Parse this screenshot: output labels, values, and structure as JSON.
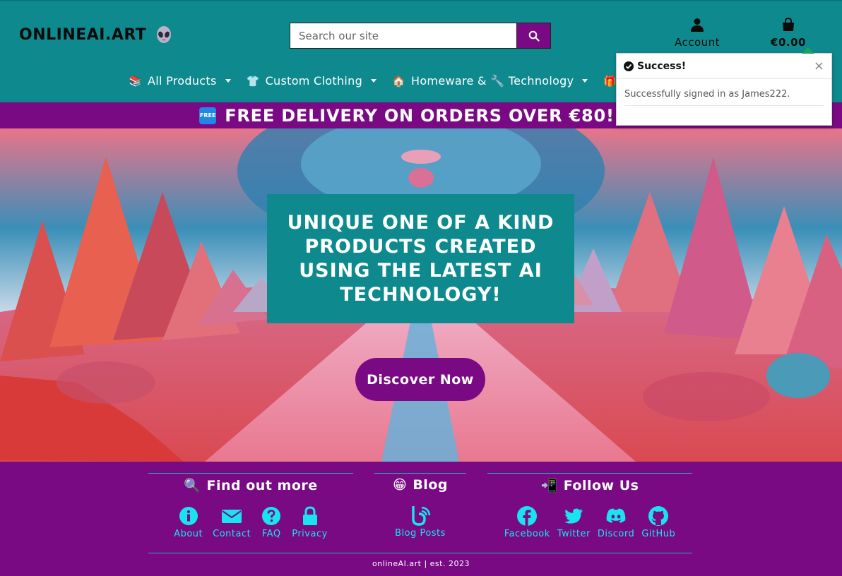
{
  "header": {
    "logo_text": "ONLINEAI.ART",
    "search_placeholder": "Search our site",
    "account_label": "Account",
    "cart_total": "€0.00"
  },
  "nav": {
    "items": [
      {
        "emoji": "📚",
        "label": "All Products"
      },
      {
        "emoji": "👕",
        "label": "Custom Clothing"
      },
      {
        "emoji": "🏠",
        "label": "Homeware & 🔧 Technology"
      },
      {
        "emoji": "🎁",
        "label": ""
      }
    ]
  },
  "banner": {
    "badge": "FREE",
    "text": "FREE DELIVERY ON ORDERS OVER €80!"
  },
  "toast": {
    "title": "Success!",
    "close": "×",
    "message": "Successfully signed in as James222."
  },
  "hero": {
    "headline": "UNIQUE ONE OF A KIND PRODUCTS CREATED USING THE LATEST AI TECHNOLOGY!",
    "cta_label": "Discover Now"
  },
  "footer": {
    "columns": [
      {
        "emoji": "🔍",
        "title": "Find out more",
        "links": [
          {
            "icon": "info-icon",
            "label": "About"
          },
          {
            "icon": "envelope-icon",
            "label": "Contact"
          },
          {
            "icon": "question-icon",
            "label": "FAQ"
          },
          {
            "icon": "lock-icon",
            "label": "Privacy"
          }
        ]
      },
      {
        "emoji": "😁",
        "title": "Blog",
        "links": [
          {
            "icon": "blog-icon",
            "label": "Blog Posts"
          }
        ]
      },
      {
        "emoji": "📲",
        "title": "Follow Us",
        "links": [
          {
            "icon": "facebook-icon",
            "label": "Facebook"
          },
          {
            "icon": "twitter-icon",
            "label": "Twitter"
          },
          {
            "icon": "discord-icon",
            "label": "Discord"
          },
          {
            "icon": "github-icon",
            "label": "GitHub"
          }
        ]
      }
    ],
    "copyright": "onlineAI.art | est. 2023"
  },
  "colors": {
    "teal": "#0e8a8e",
    "purple": "#7a0a84",
    "cyan_link": "#19e3ee"
  }
}
